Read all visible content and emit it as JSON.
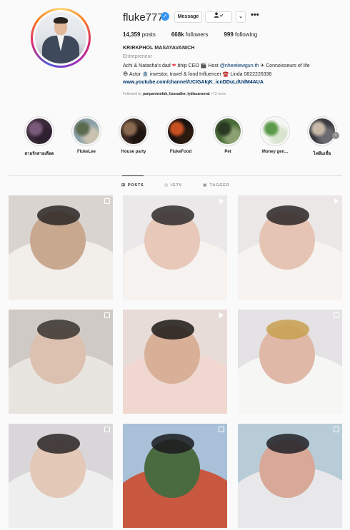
{
  "profile": {
    "username": "fluke777",
    "verified_glyph": "✓",
    "buttons": {
      "message": "Message",
      "follow_icon": "person-check-icon",
      "dropdown": "⌄",
      "more": "•••"
    },
    "stats": {
      "posts": "14,359",
      "posts_label": "posts",
      "followers": "668k",
      "followers_label": "followers",
      "following": "999",
      "following_label": "following"
    },
    "full_name": "KRIRKPHOL MASAYAVANICH",
    "category": "Entrepreneur",
    "bio_line1_a": "Achi & Natasha's dad ",
    "bio_line1_heart": "❤",
    "bio_line1_b": " bhip CEO 🎬 Host ",
    "bio_line1_mention": "@nheetiewgun.th",
    "bio_line1_c": " ✈ Connoisseurs of life",
    "bio_line2": "😎 Actor 🏦 investor, travel & food Influencer ☎️ Linda 0822226336",
    "link": "www.youtube.com/channel/UCIGAIqK_icnDDuLdUdM4AUA",
    "followed_prefix": "Followed by ",
    "followed_names": "panpantemfah, lizasadler, lydiasarunrat",
    "followed_more": " +73 more"
  },
  "highlights": [
    {
      "label": "สายรักสายเลือด",
      "colors": [
        "#3a2a3a",
        "#7a5a7a",
        "#2e2030"
      ]
    },
    {
      "label": "FlukeLee",
      "colors": [
        "#8aa0a8",
        "#5c6b4e",
        "#c9c2b0"
      ]
    },
    {
      "label": "House party",
      "colors": [
        "#3a2a22",
        "#8a6a50",
        "#1e1410"
      ]
    },
    {
      "label": "FlukeFood",
      "colors": [
        "#1a1210",
        "#c85020",
        "#2a1a10"
      ]
    },
    {
      "label": "Pet",
      "colors": [
        "#4a6a3a",
        "#2a3a22",
        "#8aa070"
      ]
    },
    {
      "label": "Money gen...",
      "colors": [
        "#f4f6f2",
        "#5a9a4a",
        "#d8e4d0"
      ]
    },
    {
      "label": "ไฟส้มเชื่อ",
      "colors": [
        "#3a3a40",
        "#c8b8a8",
        "#6a6a70"
      ]
    }
  ],
  "highlight_next": "›",
  "tabs": [
    {
      "label": "POSTS",
      "icon": "grid-icon",
      "glyph": "⊞",
      "active": true
    },
    {
      "label": "IGTV",
      "icon": "igtv-icon",
      "glyph": "◎",
      "active": false
    },
    {
      "label": "TAGGED",
      "icon": "tag-icon",
      "glyph": "▣",
      "active": false
    }
  ],
  "posts": [
    {
      "type": "multi",
      "bg": "#d9d4d0",
      "c1": "#f2eeea",
      "c2": "#c9a890",
      "c3": "#2a2624"
    },
    {
      "type": "video",
      "bg": "#eae8e9",
      "c1": "#f6f2f0",
      "c2": "#e8c8b8",
      "c3": "#2e2a2a"
    },
    {
      "type": "video",
      "bg": "#ebe7e6",
      "c1": "#f7f3f0",
      "c2": "#e6c4b4",
      "c3": "#2a2626"
    },
    {
      "type": "multi",
      "bg": "#cfcac6",
      "c1": "#e8e4e0",
      "c2": "#dcc0b0",
      "c3": "#3a3430"
    },
    {
      "type": "video",
      "bg": "#e8dcd8",
      "c1": "#f0d8d0",
      "c2": "#d8b098",
      "c3": "#1e1a18"
    },
    {
      "type": "multi",
      "bg": "#e4e2e4",
      "c1": "#f6f6f4",
      "c2": "#e0b8a8",
      "c3": "#c8a050"
    },
    {
      "type": "multi",
      "bg": "#d8d6d8",
      "c1": "#eeeeee",
      "c2": "#e4c8b8",
      "c3": "#2a2626"
    },
    {
      "type": "multi",
      "bg": "#a8c0d8",
      "c1": "#c85840",
      "c2": "#4a6a40",
      "c3": "#1a1a1e"
    },
    {
      "type": "multi",
      "bg": "#b8ccd8",
      "c1": "#e8e8ea",
      "c2": "#d8a898",
      "c3": "#202024"
    }
  ]
}
